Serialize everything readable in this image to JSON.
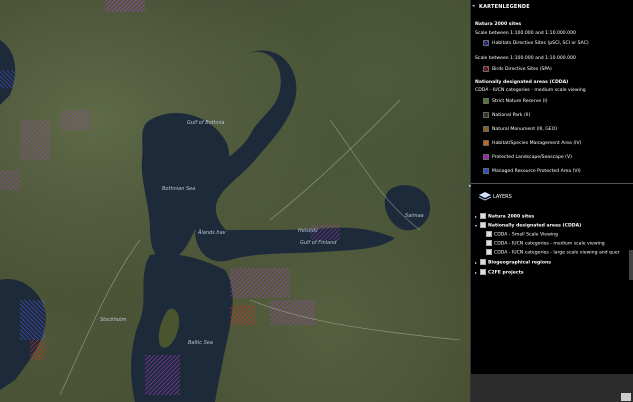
{
  "map": {
    "labels": {
      "bothnia": "Gulf of Bothnia",
      "bothnian_sea": "Bothnian Sea",
      "aland": "Ålands hav",
      "finland_gulf": "Gulf of Finland",
      "baltic": "Baltic Sea",
      "saimaa": "Saimaa",
      "stockholm": "Stockholm",
      "helsinki": "Helsinki"
    }
  },
  "legend": {
    "title": "KARTENLEGENDE",
    "natura_heading": "Natura 2000 sites",
    "scale1": "Scale between 1:100.000 and 1:10.000.000",
    "habitats": "Habitats Directive Sites (pSCI, SCI or SAC)",
    "scale2": "Scale between 1:100.000 and 1:10.000.000",
    "birds": "Birds Directive Sites (SPA)",
    "cdda_heading": "Nationally designated areas (CDDA)",
    "cdda_sub": "CDDA - IUCN categories - medium scale viewing",
    "items": [
      {
        "label": "Strict Nature Reserve (I)",
        "color": "#4d7a2a"
      },
      {
        "label": "National Park (II)",
        "color": "#2a3a1a"
      },
      {
        "label": "Natural Monument (III, GEO)",
        "color": "#8a5a2a"
      },
      {
        "label": "Habitat/Species Management Area (IV)",
        "color": "#c8641e"
      },
      {
        "label": "Protected Landscape/Seascape (V)",
        "color": "#a020b0"
      },
      {
        "label": "Managed Resource Protected Area (VI)",
        "color": "#3050c0"
      }
    ],
    "habitat_color": "#5050ff",
    "birds_color": "#e03030"
  },
  "layers": {
    "title": "LAYERS",
    "nodes": [
      {
        "label": "Natura 2000 sites",
        "bold": true,
        "expanded": false
      },
      {
        "label": "Nationally designated areas (CDDA)",
        "bold": true,
        "expanded": true
      },
      {
        "label": "CDDA - Small Scale Viewing",
        "bold": false,
        "child": true
      },
      {
        "label": "CDDA - IUCN categories - medium scale viewing",
        "bold": false,
        "child": true
      },
      {
        "label": "CDDA - IUCN categories - large scale viewing and quer",
        "bold": false,
        "child": true
      },
      {
        "label": "Biogeographical regions",
        "bold": true,
        "expanded": false
      },
      {
        "label": "C2FE projects",
        "bold": true,
        "expanded": false
      }
    ]
  }
}
